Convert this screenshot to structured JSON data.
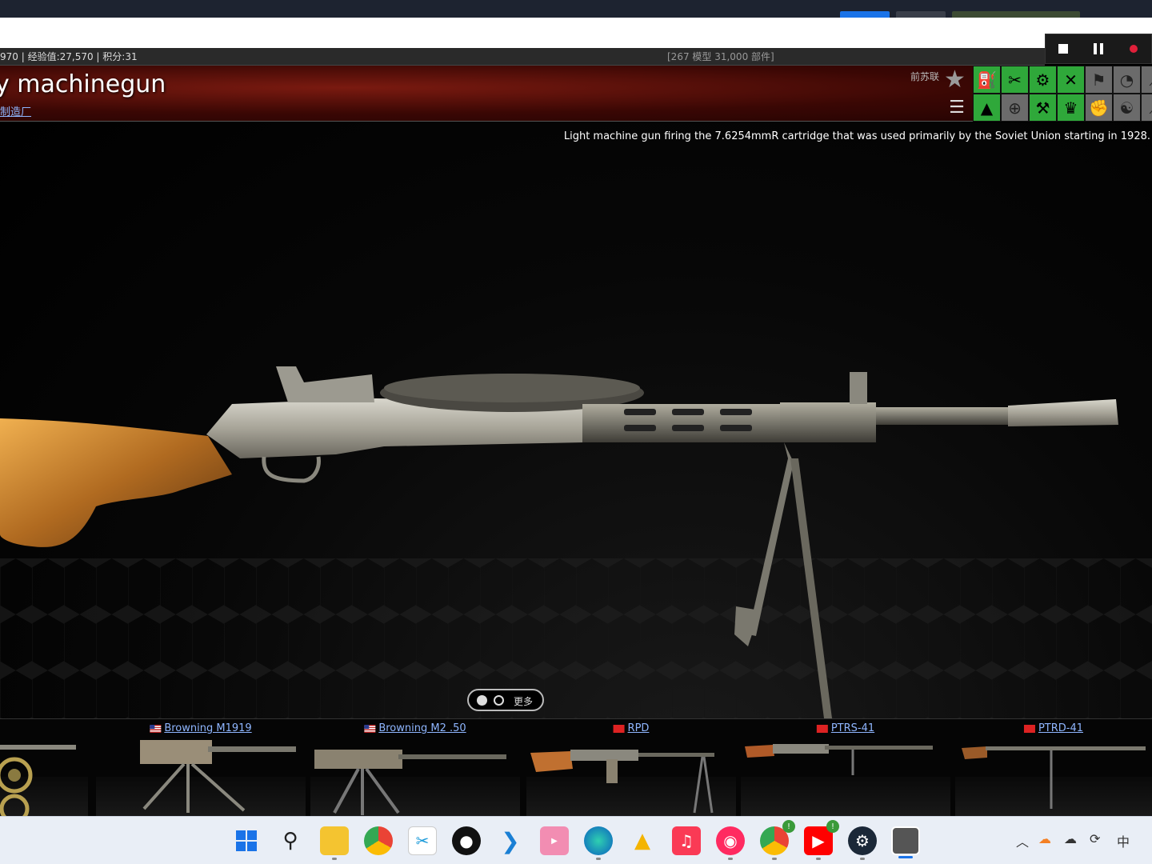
{
  "status": {
    "left_text": "970 | 经验值:27,570 | 积分:31",
    "center_text": "[267 模型 31,000 部件]"
  },
  "header": {
    "title": "y machinegun",
    "maker_link": "制造厂",
    "country": "前苏联"
  },
  "toolbar_icons": [
    "fuel-can-icon",
    "tools-icon",
    "gear-icon",
    "crossed-tools-icon",
    "checkered-flags-icon",
    "stopwatch-icon",
    "extra-icon",
    "graduation-cap-icon",
    "crosshair-icon",
    "parts-icon",
    "trophy-icon",
    "fist-icon",
    "yin-yang-icon",
    "extra-icon-2"
  ],
  "viewer": {
    "description": "Light machine gun firing the 7.6254mmR cartridge that was used primarily by the Soviet Union starting in 1928.",
    "pager_more": "更多"
  },
  "thumbnails": [
    {
      "label": "",
      "flag": ""
    },
    {
      "label": "Browning M1919",
      "flag": "us"
    },
    {
      "label": "Browning M2 .50",
      "flag": "us"
    },
    {
      "label": "RPD",
      "flag": "cn"
    },
    {
      "label": "PTRS-41",
      "flag": "cn"
    },
    {
      "label": "PTRD-41",
      "flag": "cn"
    }
  ],
  "taskbar": {
    "badge_chrome2": "!",
    "badge_youtube": "!",
    "ime": "中"
  },
  "colors": {
    "accent_green": "#2fa83a",
    "link_blue": "#8fb6ff",
    "header_red": "#7a1a10"
  }
}
